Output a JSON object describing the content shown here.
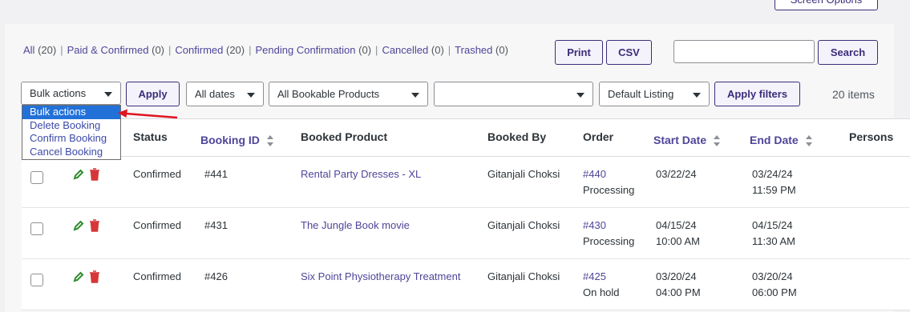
{
  "screen_options_label": "Screen Options",
  "status_links": [
    {
      "label": "All",
      "count": "(20)"
    },
    {
      "label": "Paid & Confirmed",
      "count": "(0)"
    },
    {
      "label": "Confirmed",
      "count": "(20)"
    },
    {
      "label": "Pending Confirmation",
      "count": "(0)"
    },
    {
      "label": "Cancelled",
      "count": "(0)"
    },
    {
      "label": "Trashed",
      "count": "(0)"
    }
  ],
  "buttons": {
    "print": "Print",
    "csv": "CSV",
    "search": "Search",
    "apply": "Apply",
    "apply_filters": "Apply filters"
  },
  "search": {
    "value": "",
    "placeholder": ""
  },
  "filters": {
    "bulk_actions": "Bulk actions",
    "dates": "All dates",
    "products": "All Bookable Products",
    "blank": "",
    "listing": "Default Listing"
  },
  "items_count": "20 items",
  "bulk_menu": {
    "options": [
      "Bulk actions",
      "Delete Booking",
      "Confirm Booking",
      "Cancel Booking"
    ],
    "selected": "Bulk actions"
  },
  "columns": {
    "status": "Status",
    "booking_id": "Booking ID",
    "booked_product": "Booked Product",
    "booked_by": "Booked By",
    "order": "Order",
    "start_date": "Start Date",
    "end_date": "End Date",
    "persons": "Persons"
  },
  "rows": [
    {
      "status": "Confirmed",
      "id": "#441",
      "product": "Rental Party Dresses - XL",
      "booked_by": "Gitanjali Choksi",
      "order": "#440",
      "order_status": "Processing",
      "start_date": "03/22/24",
      "start_time": "",
      "end_date": "03/24/24",
      "end_time": "11:59 PM"
    },
    {
      "status": "Confirmed",
      "id": "#431",
      "product": "The Jungle Book movie",
      "booked_by": "Gitanjali Choksi",
      "order": "#430",
      "order_status": "Processing",
      "start_date": "04/15/24",
      "start_time": "10:00 AM",
      "end_date": "04/15/24",
      "end_time": "11:30 AM"
    },
    {
      "status": "Confirmed",
      "id": "#426",
      "product": "Six Point Physiotherapy Treatment",
      "booked_by": "Gitanjali Choksi",
      "order": "#425",
      "order_status": "On hold",
      "start_date": "03/20/24",
      "start_time": "04:00 PM",
      "end_date": "03/20/24",
      "end_time": "06:00 PM"
    }
  ],
  "colors": {
    "accent": "#3c2d7a",
    "link": "#4e4599",
    "edit": "#2e8b2e",
    "delete": "#d63638",
    "highlight": "#2271d8",
    "arrow": "#e0141e"
  }
}
